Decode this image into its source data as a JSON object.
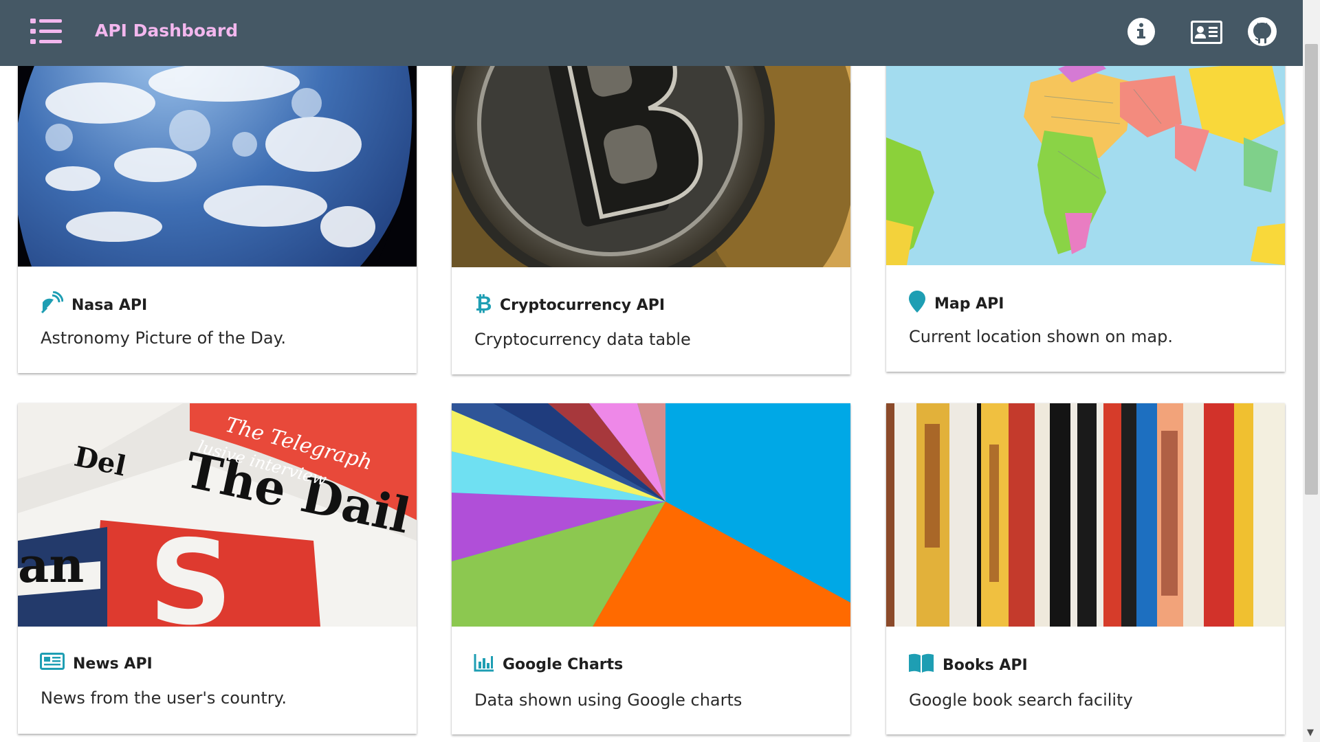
{
  "header": {
    "title": "API Dashboard"
  },
  "icons": {
    "menu": "list-icon",
    "info": "info-circle-icon",
    "contact": "address-card-icon",
    "github": "github-icon"
  },
  "colors": {
    "topbar": "#455865",
    "title": "#f3b7ee",
    "accent": "#1e9eb3"
  },
  "cards": [
    {
      "title": "Nasa API",
      "description": "Astronomy Picture of the Day.",
      "icon": "satellite-dish-icon",
      "image": "earth-image"
    },
    {
      "title": "Cryptocurrency API",
      "description": "Cryptocurrency data table",
      "icon": "bitcoin-icon",
      "image": "bitcoin-coins-image"
    },
    {
      "title": "Map API",
      "description": "Current location shown on map.",
      "icon": "map-marker-icon",
      "image": "world-map-image"
    },
    {
      "title": "News API",
      "description": "News from the user's country.",
      "icon": "newspaper-icon",
      "image": "newspapers-image"
    },
    {
      "title": "Google Charts",
      "description": "Data shown using Google charts",
      "icon": "chart-bar-icon",
      "image": "pie-chart-image"
    },
    {
      "title": "Books API",
      "description": "Google book search facility",
      "icon": "book-open-icon",
      "image": "bookshelf-image"
    }
  ]
}
